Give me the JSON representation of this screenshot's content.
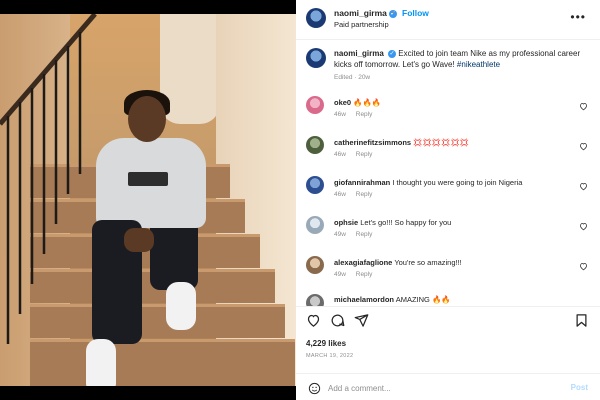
{
  "post": {
    "username": "naomi_girma",
    "follow_label": "Follow",
    "separator": "•",
    "partnership": "Paid partnership",
    "more_label": "•••"
  },
  "caption": {
    "username": "naomi_girma",
    "text": "Excited to join team Nike as my professional career kicks off tomorrow. Let's go Wave!",
    "hashtag": "#nikeathlete",
    "meta": "Edited · 20w"
  },
  "comments": [
    {
      "username": "oke0",
      "text": "🔥🔥🔥",
      "age": "46w",
      "reply": "Reply"
    },
    {
      "username": "catherinefitzsimmons",
      "text": "💢💢💢💢💢💢",
      "age": "46w",
      "reply": "Reply"
    },
    {
      "username": "giofannirahman",
      "text": "I thought you were going to join Nigeria",
      "age": "46w",
      "reply": "Reply"
    },
    {
      "username": "ophsie",
      "text": "Let's go!!! So happy for you",
      "age": "49w",
      "reply": "Reply"
    },
    {
      "username": "alexagiafaglione",
      "text": "You're so amazing!!!",
      "age": "49w",
      "reply": "Reply"
    },
    {
      "username": "michaelamordon",
      "text": "AMAZING 🔥🔥",
      "age": "",
      "reply": ""
    }
  ],
  "stats": {
    "likes": "4,229 likes",
    "date": "MARCH 19, 2022"
  },
  "add_comment": {
    "placeholder": "Add a comment...",
    "post_label": "Post"
  },
  "colors": {
    "accent": "#0095f6",
    "verified": "#3897f0",
    "muted": "#8e8e8e",
    "post_disabled": "#b3dbff"
  }
}
